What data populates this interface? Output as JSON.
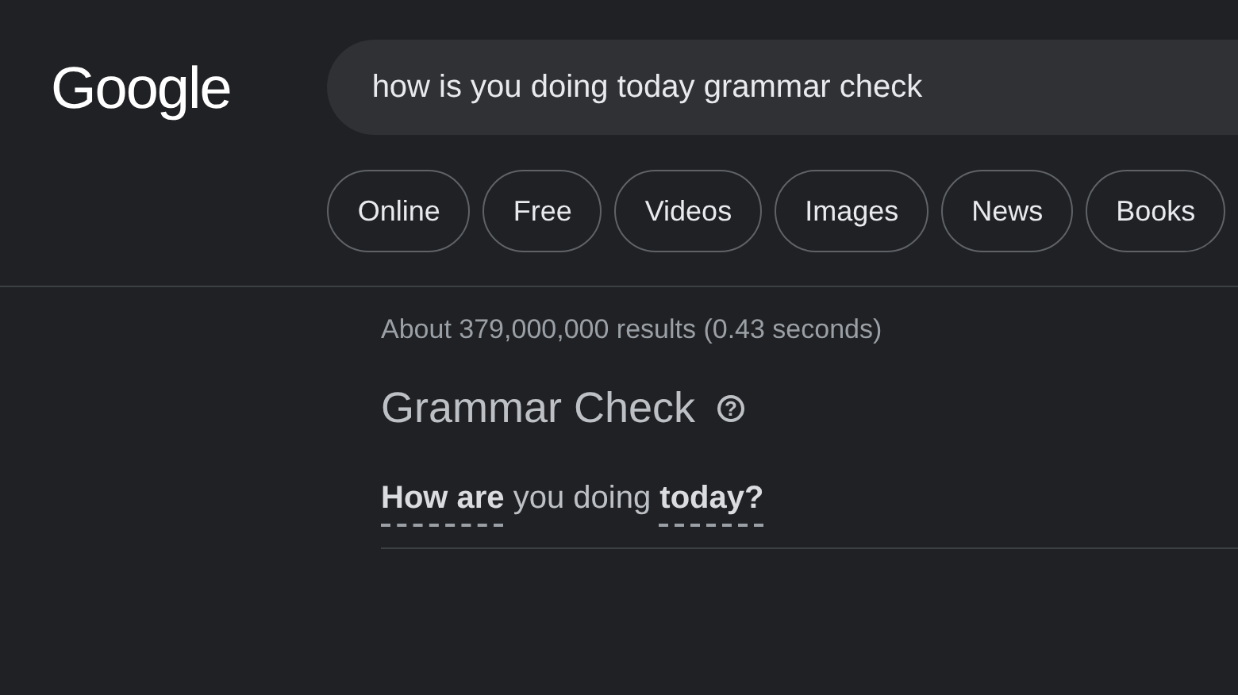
{
  "logo": "Google",
  "search": {
    "value": "how is you doing today grammar check"
  },
  "chips": [
    "Online",
    "Free",
    "Videos",
    "Images",
    "News",
    "Books"
  ],
  "result_stats": "About 379,000,000 results (0.43 seconds)",
  "grammar_check": {
    "title": "Grammar Check",
    "help_icon": "?",
    "correction": "**How are** you doing **today?**"
  }
}
